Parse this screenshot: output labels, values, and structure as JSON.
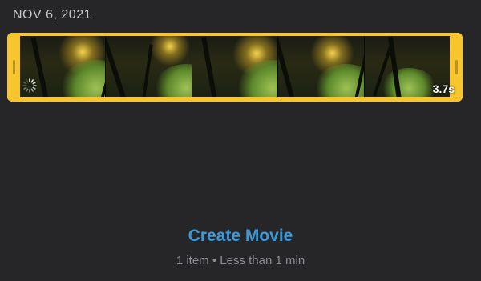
{
  "header": {
    "date": "NOV 6, 2021"
  },
  "clip": {
    "duration": "3.7s",
    "accent_color": "#f7c62f",
    "loading_icon": "activity-spinner-icon"
  },
  "footer": {
    "action_label": "Create Movie",
    "action_color": "#3a9ad9",
    "item_count": "1 item",
    "separator": "•",
    "length": "Less than 1 min"
  }
}
